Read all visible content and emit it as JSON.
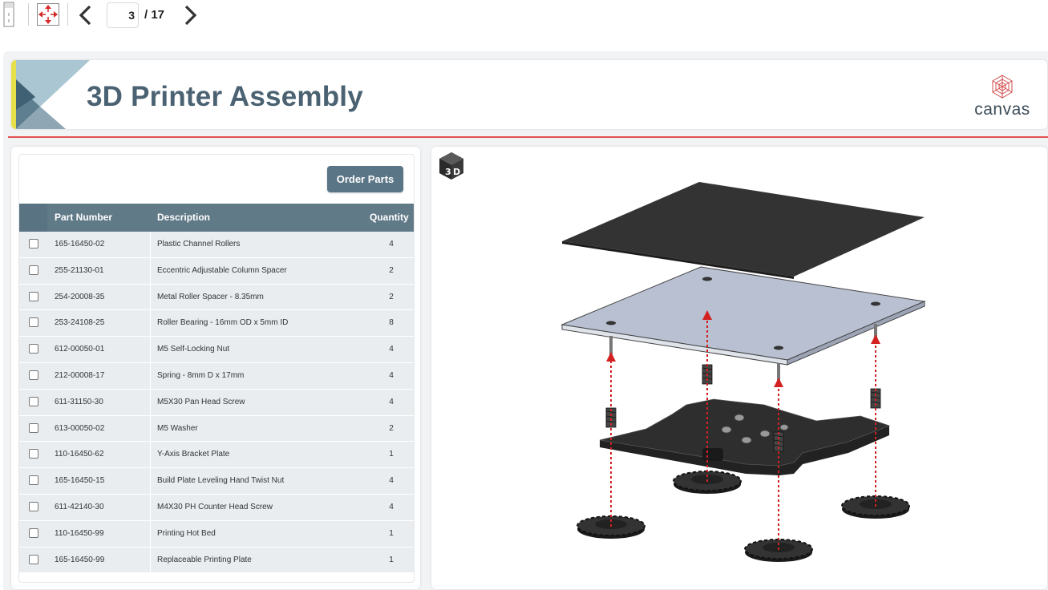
{
  "toolbar": {
    "current_page": "3",
    "total_pages": "/ 17",
    "icons": [
      "panel-toggle-icon",
      "fit-to-page-icon",
      "chevron-left-icon",
      "chevron-right-icon"
    ]
  },
  "header": {
    "title": "3D Printer Assembly",
    "brand": "canvas"
  },
  "parts": {
    "order_button": "Order Parts",
    "columns": {
      "part_number": "Part Number",
      "description": "Description",
      "quantity": "Quantity"
    },
    "rows": [
      {
        "part_number": "165-16450-02",
        "description": "Plastic Channel Rollers",
        "quantity": "4"
      },
      {
        "part_number": "255-21130-01",
        "description": "Eccentric Adjustable Column Spacer",
        "quantity": "2"
      },
      {
        "part_number": "254-20008-35",
        "description": "Metal Roller Spacer - 8.35mm",
        "quantity": "2"
      },
      {
        "part_number": "253-24108-25",
        "description": "Roller Bearing - 16mm OD x 5mm ID",
        "quantity": "8"
      },
      {
        "part_number": "612-00050-01",
        "description": "M5 Self-Locking Nut",
        "quantity": "4"
      },
      {
        "part_number": "212-00008-17",
        "description": "Spring - 8mm D x 17mm",
        "quantity": "4"
      },
      {
        "part_number": "611-31150-30",
        "description": "M5X30 Pan Head Screw",
        "quantity": "4"
      },
      {
        "part_number": "613-00050-02",
        "description": "M5 Washer",
        "quantity": "2"
      },
      {
        "part_number": "110-16450-62",
        "description": "Y-Axis Bracket Plate",
        "quantity": "1"
      },
      {
        "part_number": "165-16450-15",
        "description": "Build Plate Leveling Hand Twist Nut",
        "quantity": "4"
      },
      {
        "part_number": "611-42140-30",
        "description": "M4X30 PH Counter Head Screw",
        "quantity": "4"
      },
      {
        "part_number": "110-16450-99",
        "description": "Printing Hot Bed",
        "quantity": "1"
      },
      {
        "part_number": "165-16450-99",
        "description": "Replaceable Printing Plate",
        "quantity": "1"
      }
    ]
  },
  "viewer": {
    "view_button_icon": "3d-view-icon",
    "view_button_label": "3D"
  },
  "colors": {
    "accent": "#5a7686",
    "table_header": "#617a88",
    "title": "#4a6272",
    "rule": "#e35050",
    "arrow": "#d42020"
  }
}
